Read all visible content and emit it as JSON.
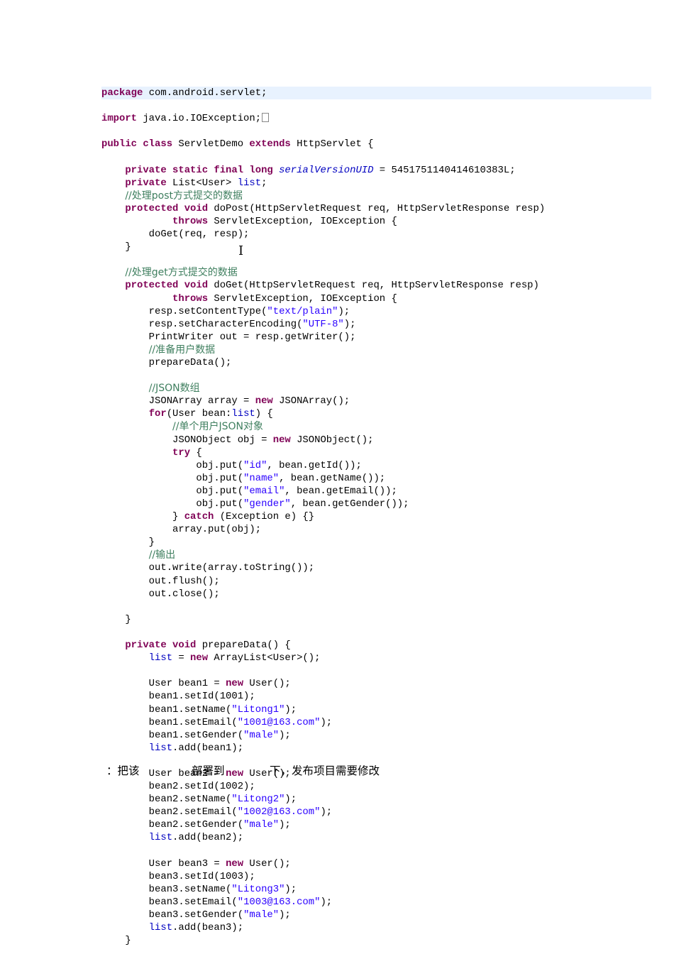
{
  "code_lines": [
    [
      [
        "k",
        "package"
      ],
      [
        "p",
        " com.android.servlet;"
      ]
    ],
    [],
    [
      [
        "k",
        "import"
      ],
      [
        "p",
        " java.io.IOException;"
      ],
      [
        "box",
        ""
      ]
    ],
    [],
    [
      [
        "k",
        "public class"
      ],
      [
        "p",
        " ServletDemo "
      ],
      [
        "k",
        "extends"
      ],
      [
        "p",
        " HttpServlet {"
      ]
    ],
    [],
    [
      [
        "p",
        "    "
      ],
      [
        "k",
        "private static final long"
      ],
      [
        "p",
        " "
      ],
      [
        "fi",
        "serialVersionUID"
      ],
      [
        "p",
        " = 5451751140414610383L;"
      ]
    ],
    [
      [
        "p",
        "    "
      ],
      [
        "k",
        "private"
      ],
      [
        "p",
        " List<User> "
      ],
      [
        "f",
        "list"
      ],
      [
        "p",
        ";"
      ]
    ],
    [
      [
        "p",
        "    "
      ],
      [
        "c",
        "//处理post方式提交的数据"
      ]
    ],
    [
      [
        "p",
        "    "
      ],
      [
        "k",
        "protected void"
      ],
      [
        "p",
        " doPost(HttpServletRequest req, HttpServletResponse resp)"
      ]
    ],
    [
      [
        "p",
        "            "
      ],
      [
        "k",
        "throws"
      ],
      [
        "p",
        " ServletException, IOException {"
      ]
    ],
    [
      [
        "p",
        "        doGet(req, resp);"
      ]
    ],
    [
      [
        "p",
        "    }"
      ]
    ],
    [],
    [
      [
        "p",
        "    "
      ],
      [
        "c",
        "//处理get方式提交的数据"
      ]
    ],
    [
      [
        "p",
        "    "
      ],
      [
        "k",
        "protected void"
      ],
      [
        "p",
        " doGet(HttpServletRequest req, HttpServletResponse resp)"
      ]
    ],
    [
      [
        "p",
        "            "
      ],
      [
        "k",
        "throws"
      ],
      [
        "p",
        " ServletException, IOException {"
      ]
    ],
    [
      [
        "p",
        "        resp.setContentType("
      ],
      [
        "s",
        "\"text/plain\""
      ],
      [
        "p",
        ");"
      ]
    ],
    [
      [
        "p",
        "        resp.setCharacterEncoding("
      ],
      [
        "s",
        "\"UTF-8\""
      ],
      [
        "p",
        ");"
      ]
    ],
    [
      [
        "p",
        "        PrintWriter out = resp.getWriter();"
      ]
    ],
    [
      [
        "p",
        "        "
      ],
      [
        "c",
        "//准备用户数据"
      ]
    ],
    [
      [
        "p",
        "        prepareData();"
      ]
    ],
    [],
    [
      [
        "p",
        "        "
      ],
      [
        "c",
        "//JSON数组"
      ]
    ],
    [
      [
        "p",
        "        JSONArray array = "
      ],
      [
        "k",
        "new"
      ],
      [
        "p",
        " JSONArray();"
      ]
    ],
    [
      [
        "p",
        "        "
      ],
      [
        "k",
        "for"
      ],
      [
        "p",
        "(User bean:"
      ],
      [
        "f",
        "list"
      ],
      [
        "p",
        ") {"
      ]
    ],
    [
      [
        "p",
        "            "
      ],
      [
        "c",
        "//单个用户JSON对象"
      ]
    ],
    [
      [
        "p",
        "            JSONObject obj = "
      ],
      [
        "k",
        "new"
      ],
      [
        "p",
        " JSONObject();"
      ]
    ],
    [
      [
        "p",
        "            "
      ],
      [
        "k",
        "try"
      ],
      [
        "p",
        " {"
      ]
    ],
    [
      [
        "p",
        "                obj.put("
      ],
      [
        "s",
        "\"id\""
      ],
      [
        "p",
        ", bean.getId());"
      ]
    ],
    [
      [
        "p",
        "                obj.put("
      ],
      [
        "s",
        "\"name\""
      ],
      [
        "p",
        ", bean.getName());"
      ]
    ],
    [
      [
        "p",
        "                obj.put("
      ],
      [
        "s",
        "\"email\""
      ],
      [
        "p",
        ", bean.getEmail());"
      ]
    ],
    [
      [
        "p",
        "                obj.put("
      ],
      [
        "s",
        "\"gender\""
      ],
      [
        "p",
        ", bean.getGender());"
      ]
    ],
    [
      [
        "p",
        "            } "
      ],
      [
        "k",
        "catch"
      ],
      [
        "p",
        " (Exception e) {}"
      ]
    ],
    [
      [
        "p",
        "            array.put(obj);"
      ]
    ],
    [
      [
        "p",
        "        }"
      ]
    ],
    [
      [
        "p",
        "        "
      ],
      [
        "c",
        "//输出"
      ]
    ],
    [
      [
        "p",
        "        out.write(array.toString());"
      ]
    ],
    [
      [
        "p",
        "        out.flush();"
      ]
    ],
    [
      [
        "p",
        "        out.close();"
      ]
    ],
    [],
    [
      [
        "p",
        "    }"
      ]
    ],
    [],
    [
      [
        "p",
        "    "
      ],
      [
        "k",
        "private void"
      ],
      [
        "p",
        " prepareData() {"
      ]
    ],
    [
      [
        "p",
        "        "
      ],
      [
        "f",
        "list"
      ],
      [
        "p",
        " = "
      ],
      [
        "k",
        "new"
      ],
      [
        "p",
        " ArrayList<User>();"
      ]
    ],
    [],
    [
      [
        "p",
        "        User bean1 = "
      ],
      [
        "k",
        "new"
      ],
      [
        "p",
        " User();"
      ]
    ],
    [
      [
        "p",
        "        bean1.setId(1001);"
      ]
    ],
    [
      [
        "p",
        "        bean1.setName("
      ],
      [
        "s",
        "\"Litong1\""
      ],
      [
        "p",
        ");"
      ]
    ],
    [
      [
        "p",
        "        bean1.setEmail("
      ],
      [
        "s",
        "\"1001@163.com\""
      ],
      [
        "p",
        ");"
      ]
    ],
    [
      [
        "p",
        "        bean1.setGender("
      ],
      [
        "s",
        "\"male\""
      ],
      [
        "p",
        ");"
      ]
    ],
    [
      [
        "p",
        "        "
      ],
      [
        "f",
        "list"
      ],
      [
        "p",
        ".add(bean1);"
      ]
    ],
    [],
    [
      [
        "p",
        "        User bean2 = "
      ],
      [
        "k",
        "new"
      ],
      [
        "p",
        " User();"
      ]
    ],
    [
      [
        "p",
        "        bean2.setId(1002);"
      ]
    ],
    [
      [
        "p",
        "        bean2.setName("
      ],
      [
        "s",
        "\"Litong2\""
      ],
      [
        "p",
        ");"
      ]
    ],
    [
      [
        "p",
        "        bean2.setEmail("
      ],
      [
        "s",
        "\"1002@163.com\""
      ],
      [
        "p",
        ");"
      ]
    ],
    [
      [
        "p",
        "        bean2.setGender("
      ],
      [
        "s",
        "\"male\""
      ],
      [
        "p",
        ");"
      ]
    ],
    [
      [
        "p",
        "        "
      ],
      [
        "f",
        "list"
      ],
      [
        "p",
        ".add(bean2);"
      ]
    ],
    [],
    [
      [
        "p",
        "        User bean3 = "
      ],
      [
        "k",
        "new"
      ],
      [
        "p",
        " User();"
      ]
    ],
    [
      [
        "p",
        "        bean3.setId(1003);"
      ]
    ],
    [
      [
        "p",
        "        bean3.setName("
      ],
      [
        "s",
        "\"Litong3\""
      ],
      [
        "p",
        ");"
      ]
    ],
    [
      [
        "p",
        "        bean3.setEmail("
      ],
      [
        "s",
        "\"1003@163.com\""
      ],
      [
        "p",
        ");"
      ]
    ],
    [
      [
        "p",
        "        bean3.setGender("
      ],
      [
        "s",
        "\"male\""
      ],
      [
        "p",
        ");"
      ]
    ],
    [
      [
        "p",
        "        "
      ],
      [
        "f",
        "list"
      ],
      [
        "p",
        ".add(bean3);"
      ]
    ],
    [
      [
        "p",
        "    }"
      ]
    ]
  ],
  "overlay": {
    "part1": "：把该",
    "part2": "部署到",
    "part3": "下，发布项目需要修改"
  },
  "cursor_glyph": "I"
}
